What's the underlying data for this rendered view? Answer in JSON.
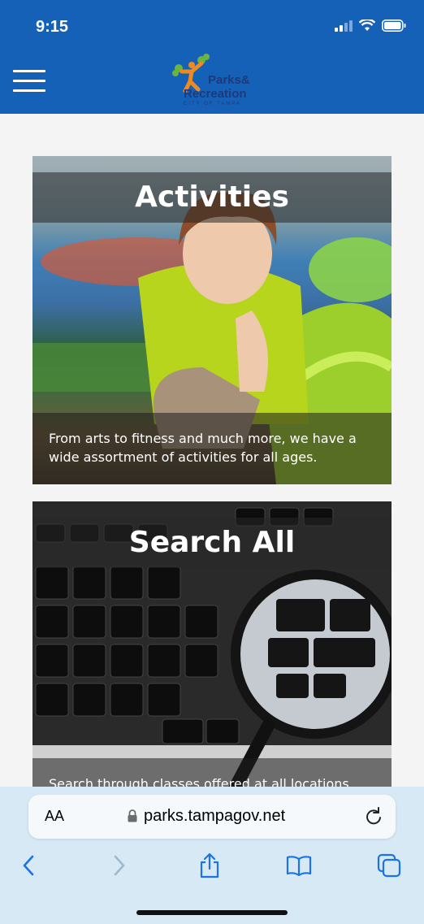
{
  "status": {
    "time": "9:15"
  },
  "header": {
    "logo_line1": "Parks&",
    "logo_line2": "Recreation",
    "logo_line3": "CITY OF TAMPA"
  },
  "cards": [
    {
      "title": "Activities",
      "description": "From arts to fitness and much more, we have a wide assortment of activities for all ages."
    },
    {
      "title": "Search All",
      "description": "Search through classes offered at all locations"
    }
  ],
  "browser": {
    "aa_label": "AA",
    "url": "parks.tampagov.net"
  },
  "colors": {
    "header_blue": "#1561b8",
    "chrome_bg": "#d8e9f6",
    "ios_blue": "#1a73e8"
  }
}
